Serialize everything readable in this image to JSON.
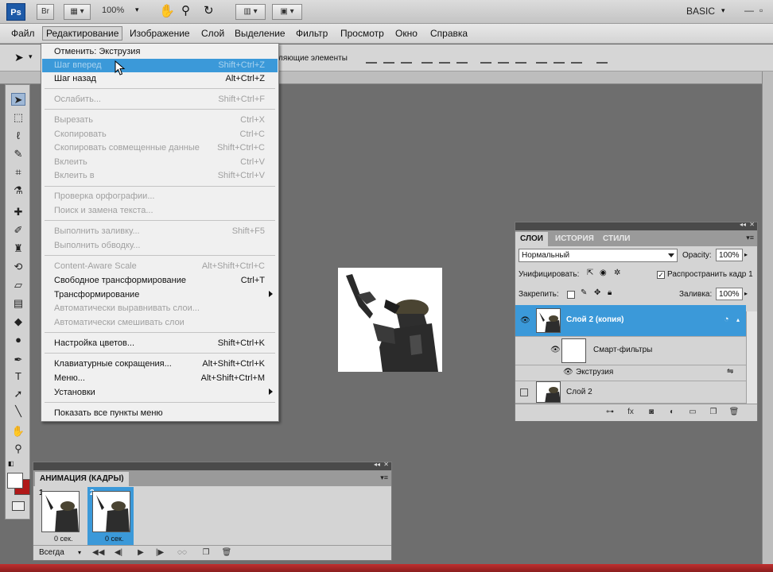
{
  "app": {
    "logo": "Ps",
    "bridge_label": "Br",
    "zoom": "100%",
    "workspace": "BASIC"
  },
  "menubar": {
    "items": [
      "Файл",
      "Редактирование",
      "Изображение",
      "Слой",
      "Выделение",
      "Фильтр",
      "Просмотр",
      "Окно",
      "Справка"
    ],
    "active": "Редактирование"
  },
  "options_bar": {
    "partial_label": "ляющие элементы"
  },
  "edit_menu": {
    "items": [
      {
        "label": "Отменить: Экструзия",
        "shortcut": "",
        "state": "normal"
      },
      {
        "label": "Шаг вперед",
        "shortcut": "Shift+Ctrl+Z",
        "state": "highlighted"
      },
      {
        "label": "Шаг назад",
        "shortcut": "Alt+Ctrl+Z",
        "state": "normal"
      },
      {
        "label": "Ослабить...",
        "shortcut": "Shift+Ctrl+F",
        "state": "disabled"
      },
      {
        "label": "Вырезать",
        "shortcut": "Ctrl+X",
        "state": "disabled"
      },
      {
        "label": "Скопировать",
        "shortcut": "Ctrl+C",
        "state": "disabled"
      },
      {
        "label": "Скопировать совмещенные данные",
        "shortcut": "Shift+Ctrl+C",
        "state": "disabled"
      },
      {
        "label": "Вклеить",
        "shortcut": "Ctrl+V",
        "state": "disabled"
      },
      {
        "label": "Вклеить в",
        "shortcut": "Shift+Ctrl+V",
        "state": "disabled"
      },
      {
        "label": "Проверка орфографии...",
        "shortcut": "",
        "state": "disabled"
      },
      {
        "label": "Поиск и замена текста...",
        "shortcut": "",
        "state": "disabled"
      },
      {
        "label": "Выполнить заливку...",
        "shortcut": "Shift+F5",
        "state": "disabled"
      },
      {
        "label": "Выполнить обводку...",
        "shortcut": "",
        "state": "disabled"
      },
      {
        "label": "Content-Aware Scale",
        "shortcut": "Alt+Shift+Ctrl+C",
        "state": "disabled"
      },
      {
        "label": "Свободное трансформирование",
        "shortcut": "Ctrl+T",
        "state": "normal"
      },
      {
        "label": "Трансформирование",
        "shortcut": "",
        "state": "submenu"
      },
      {
        "label": "Автоматически выравнивать слои...",
        "shortcut": "",
        "state": "disabled"
      },
      {
        "label": "Автоматически смешивать слои",
        "shortcut": "",
        "state": "disabled"
      },
      {
        "label": "Настройка цветов...",
        "shortcut": "Shift+Ctrl+K",
        "state": "normal"
      },
      {
        "label": "Клавиатурные сокращения...",
        "shortcut": "Alt+Shift+Ctrl+K",
        "state": "normal"
      },
      {
        "label": "Меню...",
        "shortcut": "Alt+Shift+Ctrl+M",
        "state": "normal"
      },
      {
        "label": "Установки",
        "shortcut": "",
        "state": "submenu"
      },
      {
        "label": "Показать все пункты меню",
        "shortcut": "",
        "state": "normal"
      }
    ]
  },
  "layers_panel": {
    "tabs": [
      "СЛОИ",
      "ИСТОРИЯ",
      "СТИЛИ"
    ],
    "blend_mode": "Нормальный",
    "opacity_label": "Opacity:",
    "opacity_value": "100%",
    "unify_label": "Унифицировать:",
    "propagate_label": "Распространить кадр 1",
    "lock_label": "Закрепить:",
    "fill_label": "Заливка:",
    "fill_value": "100%",
    "layers": [
      {
        "name": "Слой 2 (копия)"
      },
      {
        "name": "Смарт-фильтры"
      },
      {
        "name": "Экструзия"
      },
      {
        "name": "Слой 2"
      }
    ]
  },
  "animation_panel": {
    "tab": "АНИМАЦИЯ (КАДРЫ)",
    "frames": [
      {
        "number": "1",
        "time": "0 сек."
      },
      {
        "number": "2",
        "time": "0 сек."
      }
    ],
    "loop": "Всегда"
  },
  "colors": {
    "highlight": "#3b99d9",
    "background": "#6e6e6e"
  }
}
